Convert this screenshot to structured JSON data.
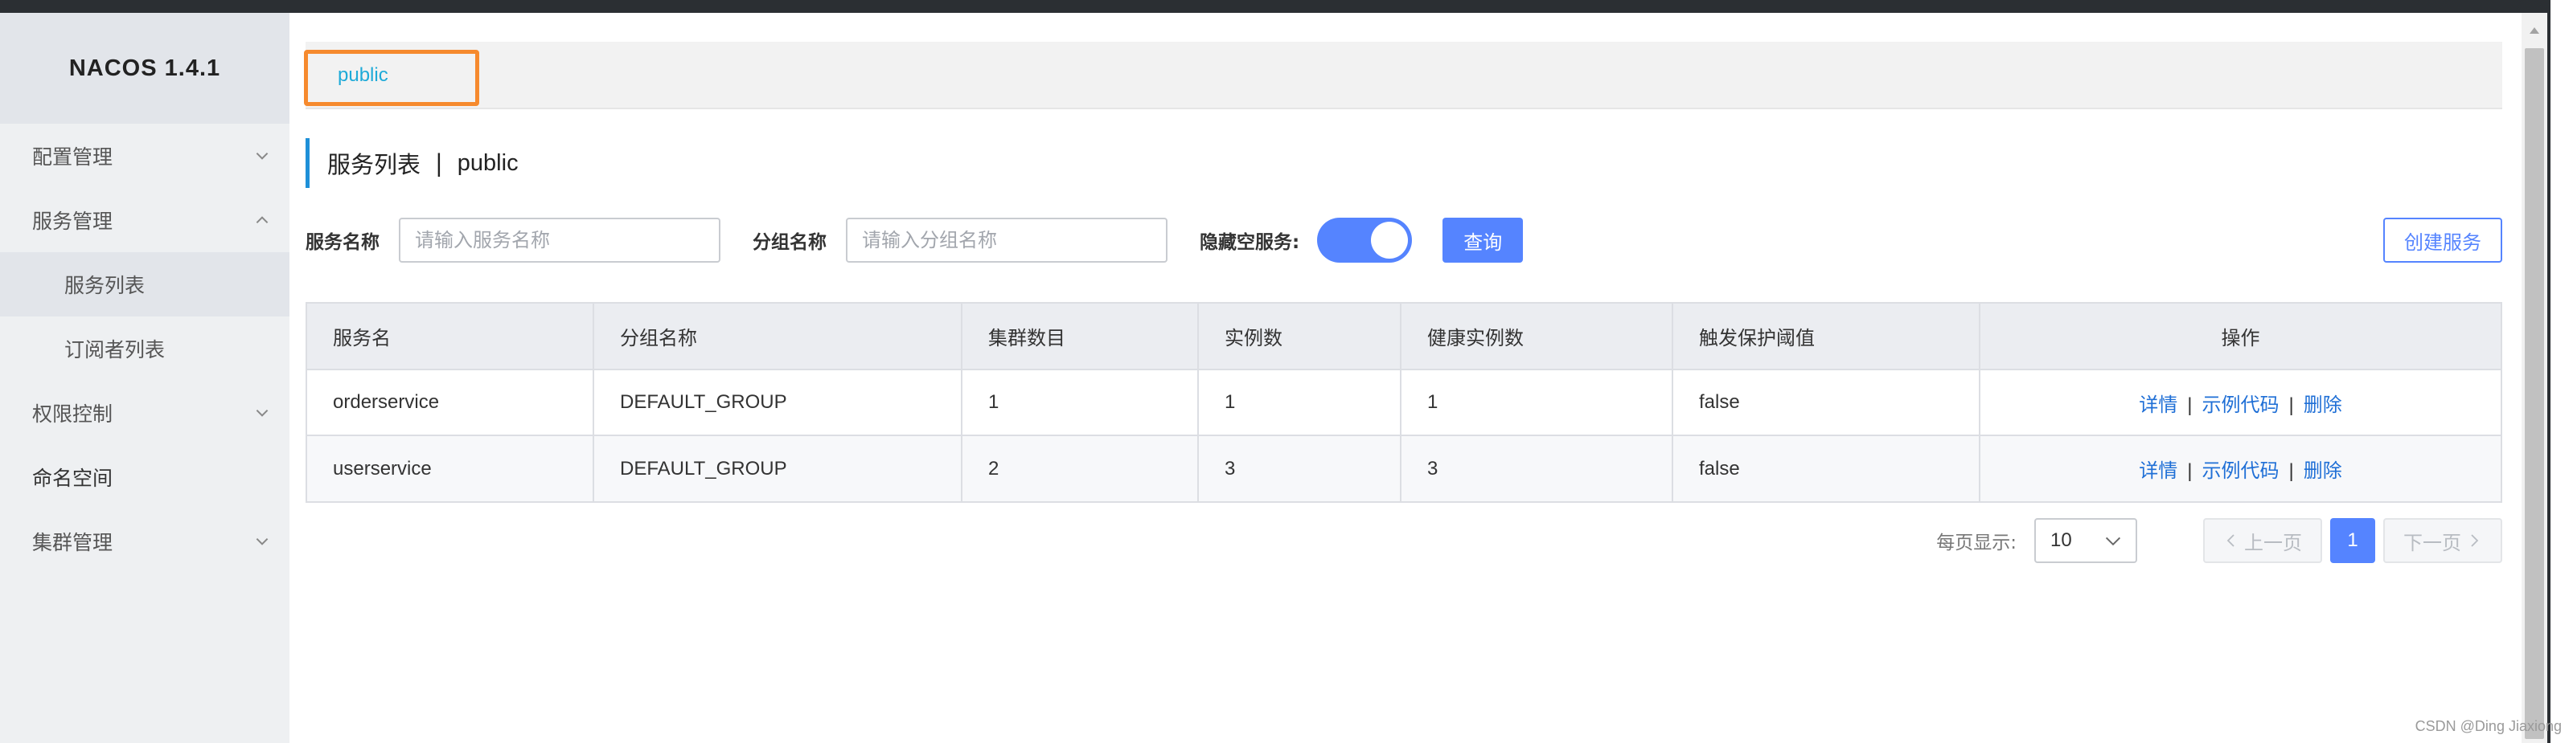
{
  "sidebar": {
    "brand": "NACOS 1.4.1",
    "items": [
      {
        "label": "配置管理"
      },
      {
        "label": "服务管理"
      },
      {
        "label": "服务列表"
      },
      {
        "label": "订阅者列表"
      },
      {
        "label": "权限控制"
      },
      {
        "label": "命名空间"
      },
      {
        "label": "集群管理"
      }
    ]
  },
  "namespace_bar": {
    "active": "public"
  },
  "title": {
    "main": "服务列表",
    "separator": "|",
    "namespace": "public"
  },
  "filters": {
    "service_name_label": "服务名称",
    "service_name_placeholder": "请输入服务名称",
    "group_name_label": "分组名称",
    "group_name_placeholder": "请输入分组名称",
    "hide_empty_label": "隐藏空服务:",
    "hide_empty_on": true,
    "query_label": "查询",
    "create_label": "创建服务"
  },
  "table": {
    "columns": [
      "服务名",
      "分组名称",
      "集群数目",
      "实例数",
      "健康实例数",
      "触发保护阈值",
      "操作"
    ],
    "rows": [
      {
        "name": "orderservice",
        "group": "DEFAULT_GROUP",
        "clusters": "1",
        "instances": "1",
        "healthy": "1",
        "threshold": "false"
      },
      {
        "name": "userservice",
        "group": "DEFAULT_GROUP",
        "clusters": "2",
        "instances": "3",
        "healthy": "3",
        "threshold": "false"
      }
    ],
    "actions": {
      "detail": "详情",
      "sample_code": "示例代码",
      "delete": "删除",
      "separator": "|"
    }
  },
  "pagination": {
    "per_page_label": "每页显示:",
    "per_page_value": "10",
    "prev_label": "上一页",
    "current_page": "1",
    "next_label": "下一页"
  },
  "watermark": "CSDN @Ding Jiaxiong",
  "colors": {
    "primary": "#5584ff",
    "link": "#1f6fd6",
    "namespace_text": "#1eaad8",
    "highlight_box": "#f68a2e",
    "sidebar_bg": "#eef0f2"
  }
}
